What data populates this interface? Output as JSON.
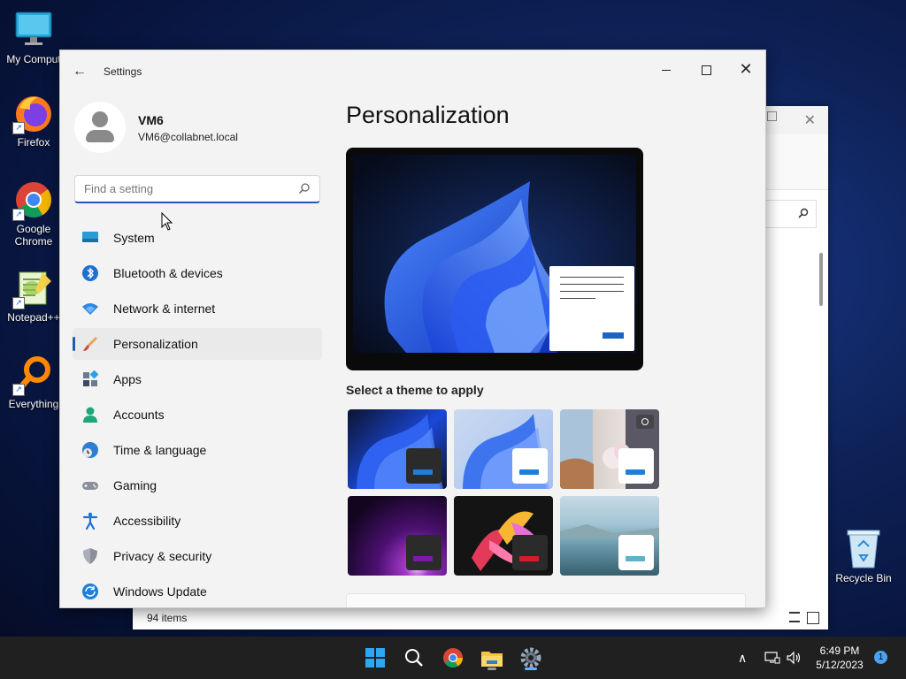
{
  "desktop": {
    "icons": [
      {
        "label": "My Comput"
      },
      {
        "label": "Firefox"
      },
      {
        "label": "Google Chrome"
      },
      {
        "label": "Notepad++"
      },
      {
        "label": "Everything"
      }
    ],
    "recycle_bin": {
      "label": "Recycle Bin"
    }
  },
  "explorer": {
    "status_items": "94 items"
  },
  "settings": {
    "title": "Settings",
    "user": {
      "name": "VM6",
      "email": "VM6@collabnet.local"
    },
    "search": {
      "placeholder": "Find a setting"
    },
    "nav": [
      {
        "label": "System",
        "icon": "monitor-icon"
      },
      {
        "label": "Bluetooth & devices",
        "icon": "bluetooth-icon"
      },
      {
        "label": "Network & internet",
        "icon": "wifi-icon"
      },
      {
        "label": "Personalization",
        "icon": "brush-icon",
        "active": true
      },
      {
        "label": "Apps",
        "icon": "apps-icon"
      },
      {
        "label": "Accounts",
        "icon": "person-icon"
      },
      {
        "label": "Time & language",
        "icon": "globe-clock-icon"
      },
      {
        "label": "Gaming",
        "icon": "controller-icon"
      },
      {
        "label": "Accessibility",
        "icon": "accessibility-icon"
      },
      {
        "label": "Privacy & security",
        "icon": "shield-icon"
      },
      {
        "label": "Windows Update",
        "icon": "refresh-icon"
      }
    ],
    "main": {
      "title": "Personalization",
      "theme_label": "Select a theme to apply"
    }
  },
  "taskbar": {
    "time": "6:49 PM",
    "date": "5/12/2023",
    "notifications": "1"
  },
  "colors": {
    "accent": "#1e5bb8",
    "taskbar": "#202020"
  }
}
